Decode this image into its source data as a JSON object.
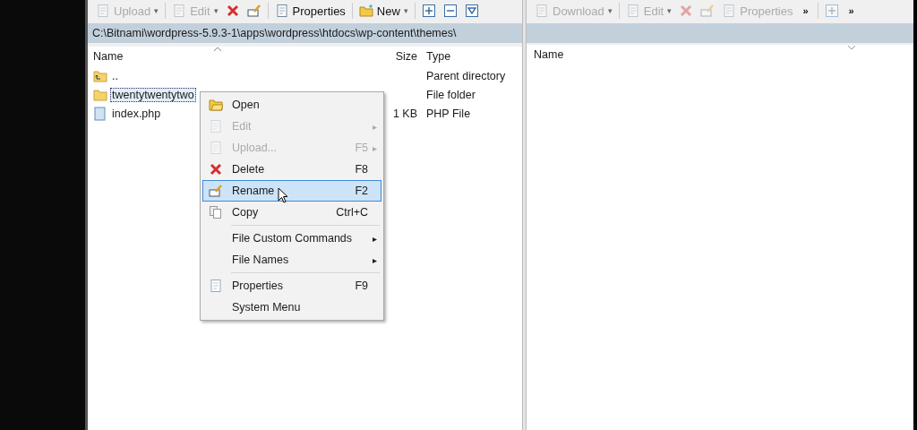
{
  "left_toolbar": [
    {
      "kind": "upload",
      "label": "Upload",
      "disabled": true,
      "dropdown": "▾"
    },
    {
      "kind": "edit",
      "label": "Edit",
      "disabled": true,
      "dropdown": "▾"
    },
    {
      "kind": "delete",
      "disabled": false
    },
    {
      "kind": "rename",
      "disabled": false
    },
    {
      "kind": "properties",
      "label": "Properties",
      "disabled": false
    },
    {
      "kind": "new",
      "label": "New",
      "disabled": false,
      "dropdown": "▾"
    },
    {
      "kind": "plus",
      "disabled": false
    },
    {
      "kind": "minus",
      "disabled": false
    },
    {
      "kind": "filter",
      "disabled": false
    }
  ],
  "right_toolbar": [
    {
      "kind": "upload",
      "label": "Download",
      "disabled": true,
      "dropdown": "▾"
    },
    {
      "kind": "edit",
      "label": "Edit",
      "disabled": true,
      "dropdown": "▾"
    },
    {
      "kind": "delete",
      "disabled": true
    },
    {
      "kind": "rename",
      "disabled": true
    },
    {
      "kind": "properties",
      "label": "Properties",
      "disabled": true
    },
    {
      "kind": "more",
      "label": "»",
      "disabled": false
    },
    {
      "kind": "plus",
      "disabled": true
    },
    {
      "kind": "more",
      "label": "»",
      "disabled": false
    }
  ],
  "left_panel": {
    "path": "C:\\Bitnami\\wordpress-5.9.3-1\\apps\\wordpress\\htdocs\\wp-content\\themes\\",
    "columns": [
      "Name",
      "Size",
      "Type"
    ],
    "rows": [
      {
        "kind": "parent",
        "name": "..",
        "type": "Parent directory",
        "selected": false
      },
      {
        "kind": "folder",
        "name": "twentytwentytwo",
        "type": "File folder",
        "selected": true
      },
      {
        "kind": "file",
        "name": "index.php",
        "size": "1 KB",
        "type": "PHP File",
        "selected": false
      }
    ]
  },
  "right_panel": {
    "columns": [
      "Name"
    ]
  },
  "context_menu": [
    {
      "kind": "open",
      "label": "Open",
      "disabled": false,
      "selected": false
    },
    {
      "kind": "edit",
      "label": "Edit",
      "disabled": true,
      "arrow": "▸",
      "selected": false
    },
    {
      "kind": "upload",
      "label": "Upload...",
      "shortcut": "F5",
      "disabled": true,
      "arrow": "▸",
      "selected": false
    },
    {
      "kind": "delete",
      "label": "Delete",
      "shortcut": "F8",
      "disabled": false,
      "selected": false
    },
    {
      "kind": "rename",
      "label": "Rename",
      "shortcut": "F2",
      "disabled": false,
      "selected": true
    },
    {
      "kind": "copy",
      "label": "Copy",
      "shortcut": "Ctrl+C",
      "disabled": false,
      "selected": false
    },
    {
      "kind": "separator"
    },
    {
      "kind": "plain",
      "label": "File Custom Commands",
      "disabled": false,
      "arrow": "▸",
      "selected": false
    },
    {
      "kind": "plain",
      "label": "File Names",
      "disabled": false,
      "arrow": "▸",
      "selected": false
    },
    {
      "kind": "separator"
    },
    {
      "kind": "properties",
      "label": "Properties",
      "shortcut": "F9",
      "disabled": false,
      "selected": false
    },
    {
      "kind": "plain",
      "label": "System Menu",
      "disabled": false,
      "selected": false
    }
  ]
}
